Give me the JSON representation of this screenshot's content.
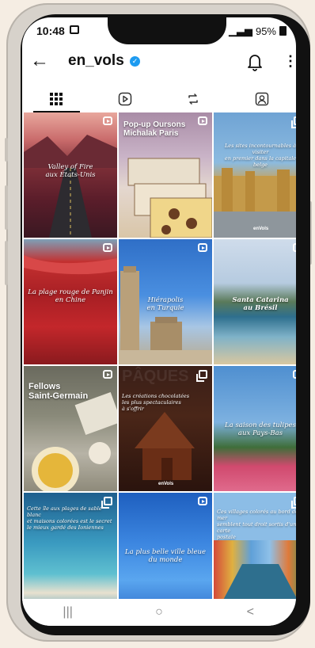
{
  "status": {
    "time": "10:48",
    "battery": "95%"
  },
  "header": {
    "username": "en_vols",
    "verified_mark": "✓",
    "back_glyph": "←",
    "more_glyph": "⋮"
  },
  "tabs": [
    {
      "name": "grid"
    },
    {
      "name": "reels"
    },
    {
      "name": "reposts"
    },
    {
      "name": "tagged"
    }
  ],
  "posts": [
    {
      "caption": "Valley of Fire\naux États-Unis",
      "badge": "reel"
    },
    {
      "caption": "Pop-up Oursons\nMichalak Paris",
      "badge": "reel"
    },
    {
      "caption": "Les sites incontournables à visiter\nen premier dans la capitale belge",
      "badge": "multi",
      "brand": "enVols"
    },
    {
      "caption": "La plage rouge de Panjin\nen Chine",
      "badge": "reel"
    },
    {
      "caption": "Hiérapolis\nen Turquie",
      "badge": "reel"
    },
    {
      "caption": "Santa Catarina\nau Brésil",
      "badge": "reel"
    },
    {
      "caption": "Fellows\nSaint-Germain",
      "badge": "reel"
    },
    {
      "caption": "Les créations chocolatées\nles plus spectaculaires\nà s'offrir",
      "badge": "multi",
      "brand": "enVols",
      "bgword": "PÂQUES"
    },
    {
      "caption": "La saison des tulipes\naux Pays-Bas",
      "badge": "reel"
    },
    {
      "caption": "Cette île aux plages de sable blanc\net maisons colorées est le secret\nle mieux gardé des Ioniennes",
      "badge": "multi"
    },
    {
      "caption": "La plus belle ville bleue\ndu monde",
      "badge": "reel"
    },
    {
      "caption": "Ces villages colorés au bord de la mer\nsemblent tout droit sortis d'une carte\npostale",
      "badge": "multi"
    }
  ],
  "nav": {
    "recents": "|||",
    "home": "○",
    "back": "<"
  }
}
